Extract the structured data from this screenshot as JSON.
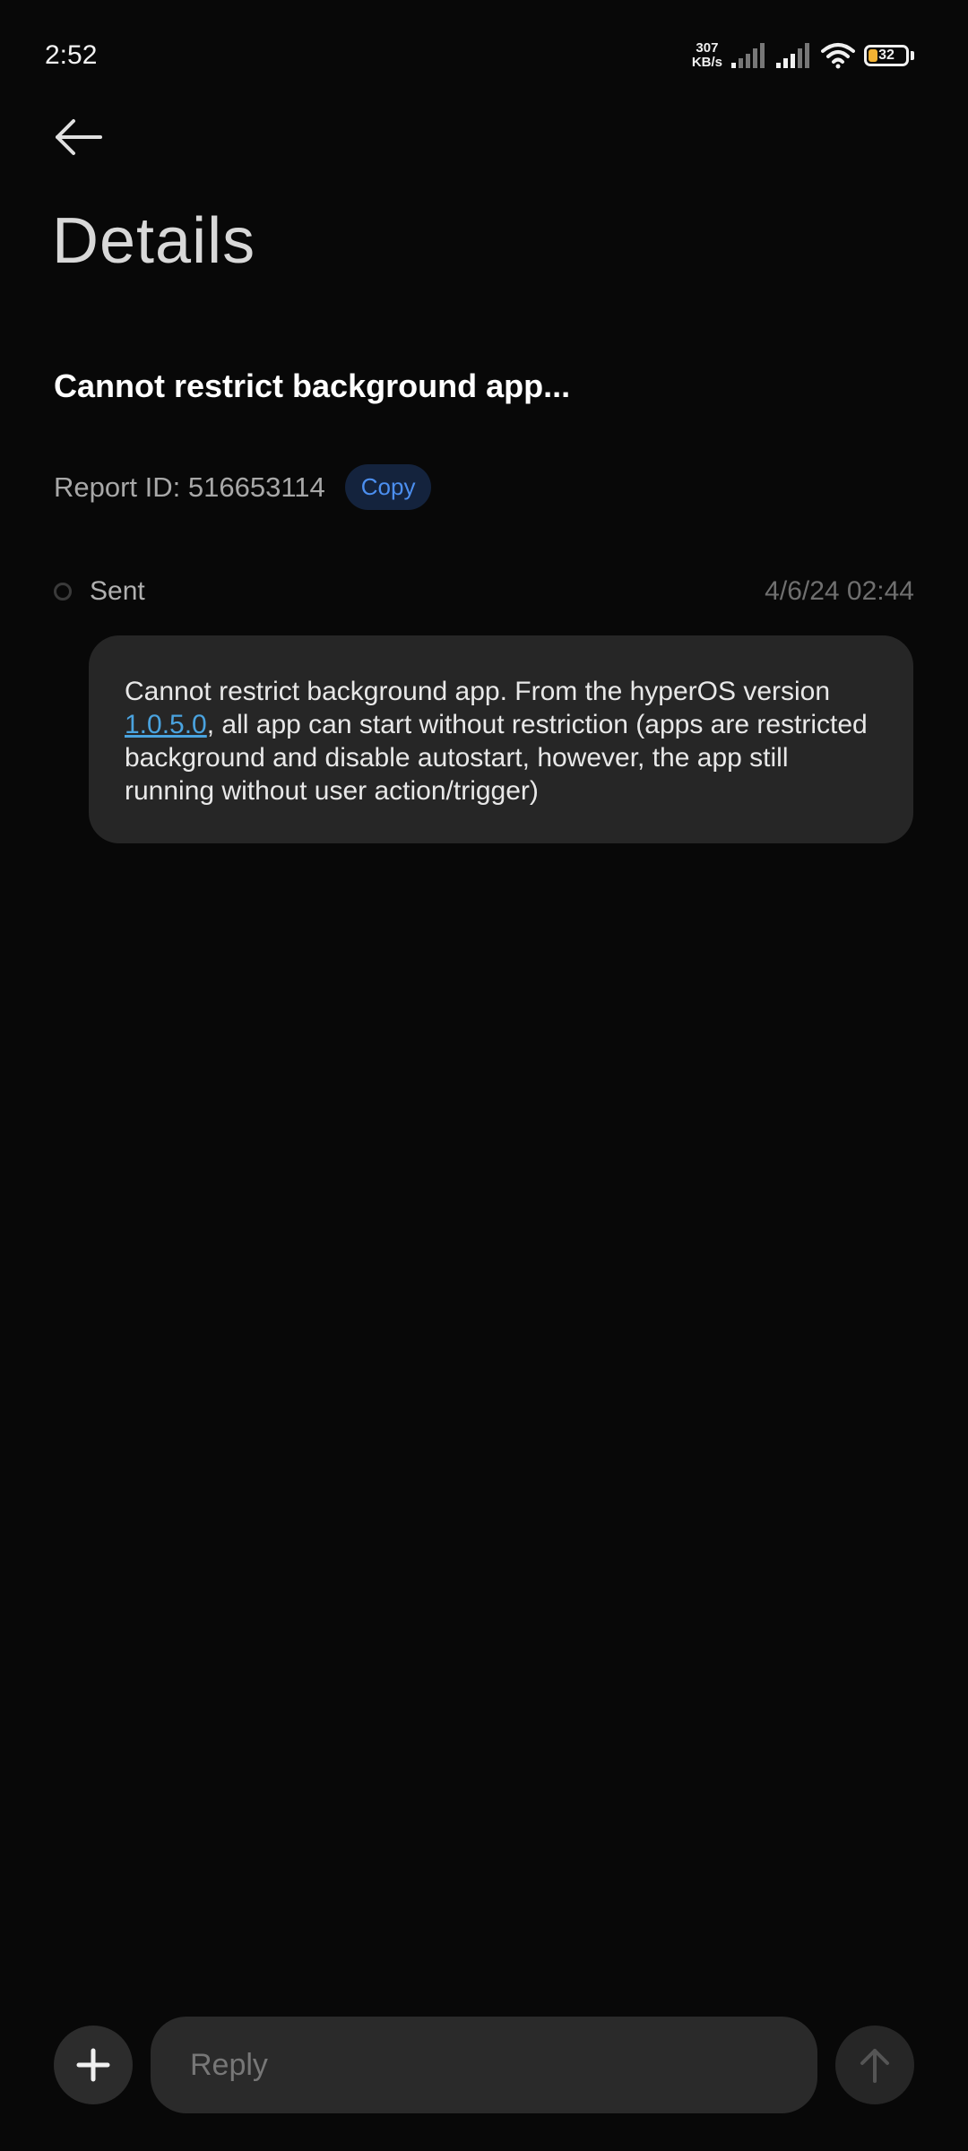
{
  "status_bar": {
    "time": "2:52",
    "net_speed_value": "307",
    "net_speed_unit": "KB/s",
    "battery_level": "32",
    "battery_color": "#f2b233"
  },
  "header": {
    "back_icon": "arrow-left-icon",
    "title": "Details"
  },
  "report": {
    "title": "Cannot restrict background app...",
    "id_label": "Report ID: 516653114",
    "copy_label": "Copy"
  },
  "timeline": {
    "status": "Sent",
    "date": "4/6/24 02:44"
  },
  "message": {
    "text_before_link": "Cannot restrict background app. From the hyperOS version ",
    "link_text": "1.0.5.0",
    "text_after_link": ", all app can start without restriction (apps are restricted background and disable autostart, however, the app still running without user action/trigger)"
  },
  "composer": {
    "add_icon": "plus-icon",
    "reply_placeholder": "Reply",
    "send_icon": "arrow-up-icon"
  },
  "colors": {
    "background": "#080808",
    "accent_blue": "#4c8ff0",
    "link_blue": "#4aa3df"
  }
}
